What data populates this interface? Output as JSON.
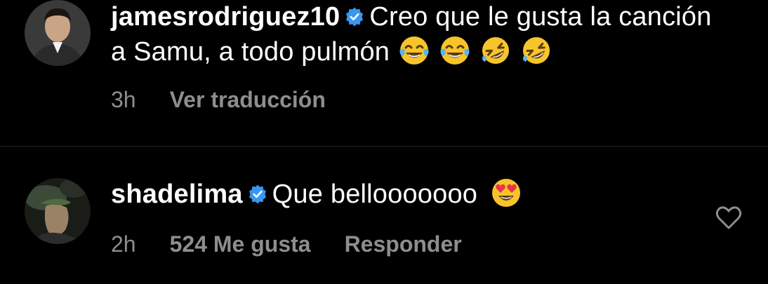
{
  "comments": [
    {
      "username": "jamesrodriguez10",
      "verified": true,
      "text": "Creo que le gusta la canción a Samu, a todo pulmón",
      "emojis": [
        "tears-of-joy-emoji",
        "tears-of-joy-emoji",
        "rolling-laughing-emoji",
        "rolling-laughing-emoji"
      ],
      "time": "3h",
      "action_translate": "Ver traducción"
    },
    {
      "username": "shadelima",
      "verified": true,
      "text": "Que bellooooooo",
      "emojis": [
        "heart-eyes-emoji"
      ],
      "time": "2h",
      "likes_label": "524 Me gusta",
      "action_reply": "Responder"
    }
  ],
  "colors": {
    "background": "#000000",
    "text": "#ffffff",
    "meta": "#8e8e8e",
    "verified": "#3897f0",
    "divider": "#262626"
  }
}
